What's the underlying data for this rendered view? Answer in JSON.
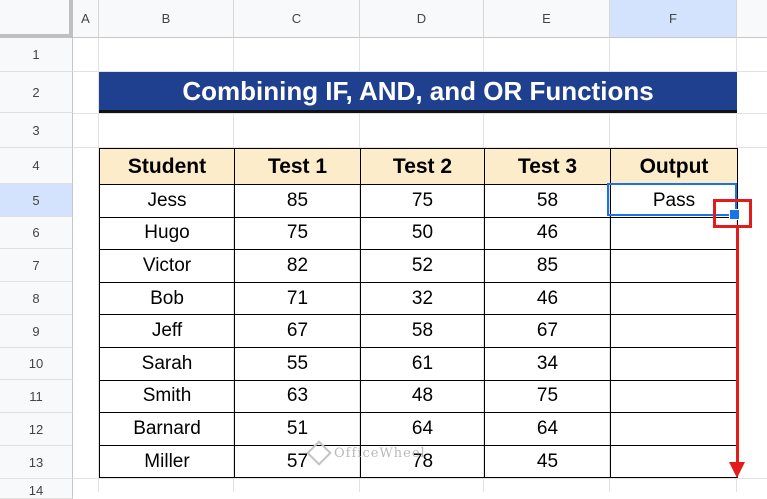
{
  "columns": [
    "A",
    "B",
    "C",
    "D",
    "E",
    "F"
  ],
  "rows": [
    "1",
    "2",
    "3",
    "4",
    "5",
    "6",
    "7",
    "8",
    "9",
    "10",
    "11",
    "12",
    "13",
    "14"
  ],
  "title": "Combining IF, AND, and OR Functions",
  "table": {
    "headers": [
      "Student",
      "Test 1",
      "Test 2",
      "Test 3",
      "Output"
    ],
    "rows": [
      [
        "Jess",
        "85",
        "75",
        "58",
        "Pass"
      ],
      [
        "Hugo",
        "75",
        "50",
        "46",
        ""
      ],
      [
        "Victor",
        "82",
        "52",
        "85",
        ""
      ],
      [
        "Bob",
        "71",
        "32",
        "46",
        ""
      ],
      [
        "Jeff",
        "67",
        "58",
        "67",
        ""
      ],
      [
        "Sarah",
        "55",
        "61",
        "34",
        ""
      ],
      [
        "Smith",
        "63",
        "48",
        "75",
        ""
      ],
      [
        "Barnard",
        "51",
        "64",
        "64",
        ""
      ],
      [
        "Miller",
        "57",
        "78",
        "45",
        ""
      ]
    ]
  },
  "watermark": "OfficeWheel",
  "colors": {
    "title_bg": "#1f3f8f",
    "header_bg": "#fcecc9",
    "selection": "#1a73e8",
    "annotation": "#e31b1b"
  }
}
